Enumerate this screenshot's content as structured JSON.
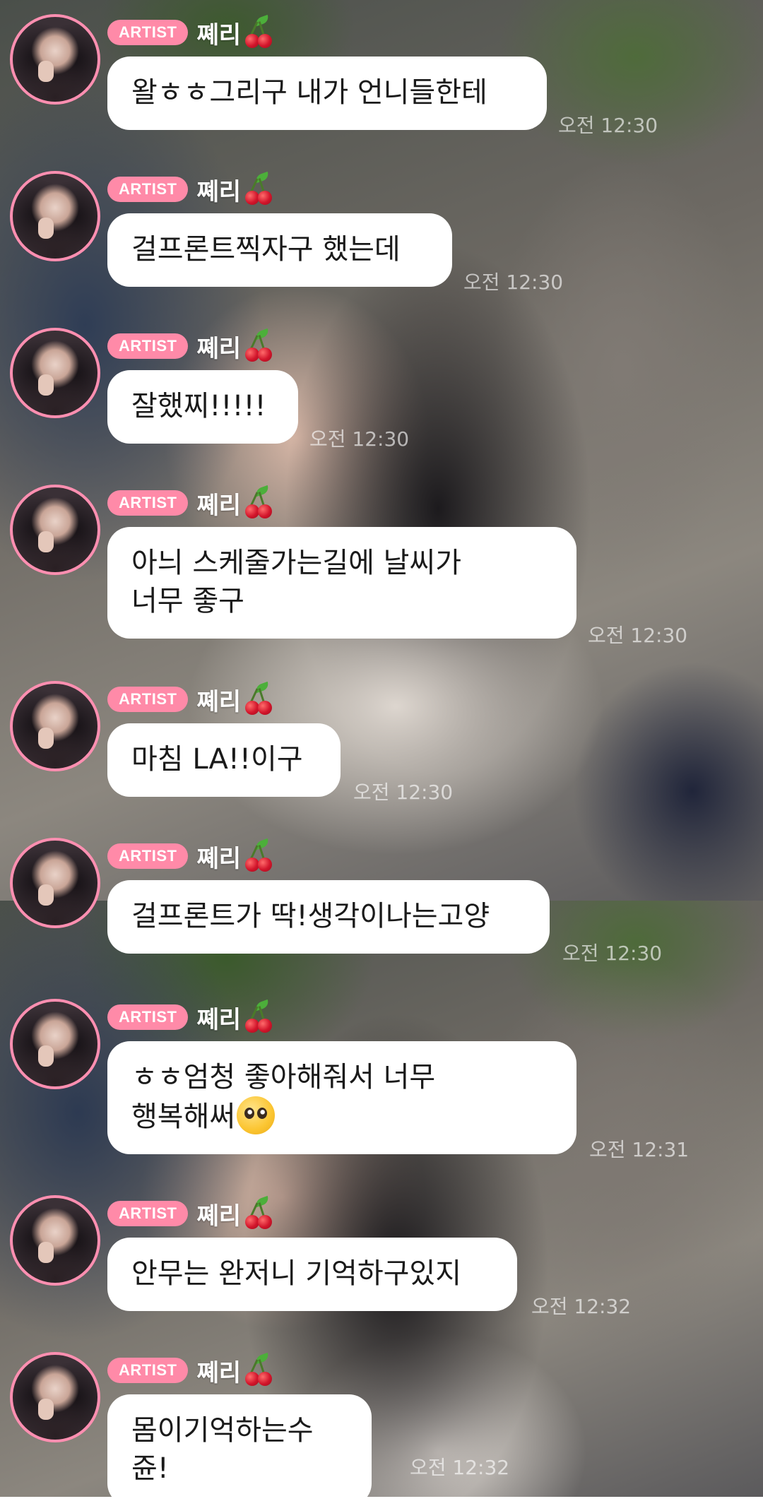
{
  "badge_label": "ARTIST",
  "sender_name": "쪠리",
  "messages": [
    {
      "text": "왈ㅎㅎ그리구 내가 언니들한테",
      "time": "오전 12:30"
    },
    {
      "text": "걸프론트찍자구 했는데",
      "time": "오전 12:30"
    },
    {
      "text": "잘했찌!!!!!",
      "time": "오전 12:30"
    },
    {
      "text": "아늬 스케줄가는길에 날씨가\n너무 좋구",
      "time": "오전 12:30"
    },
    {
      "text": "마침 LA!!이구",
      "time": "오전 12:30"
    },
    {
      "text": "걸프론트가 딱!생각이나는고양",
      "time": "오전 12:30"
    },
    {
      "text": "ㅎㅎ엄청 좋아해줘서 너무\n행복해써",
      "time": "오전 12:31"
    },
    {
      "text": "안무는 완저니 기억하구있지",
      "time": "오전 12:32"
    },
    {
      "text": "몸이기억하는수쥰!",
      "time": "오전 12:32"
    }
  ],
  "icons": {
    "badge_emoji": "cherry-icon",
    "inline_emoji": "pleading-face-icon"
  },
  "colors": {
    "badge": "#ff8aa8",
    "avatar_ring": "#ff8fb1",
    "bubble": "#ffffff"
  }
}
